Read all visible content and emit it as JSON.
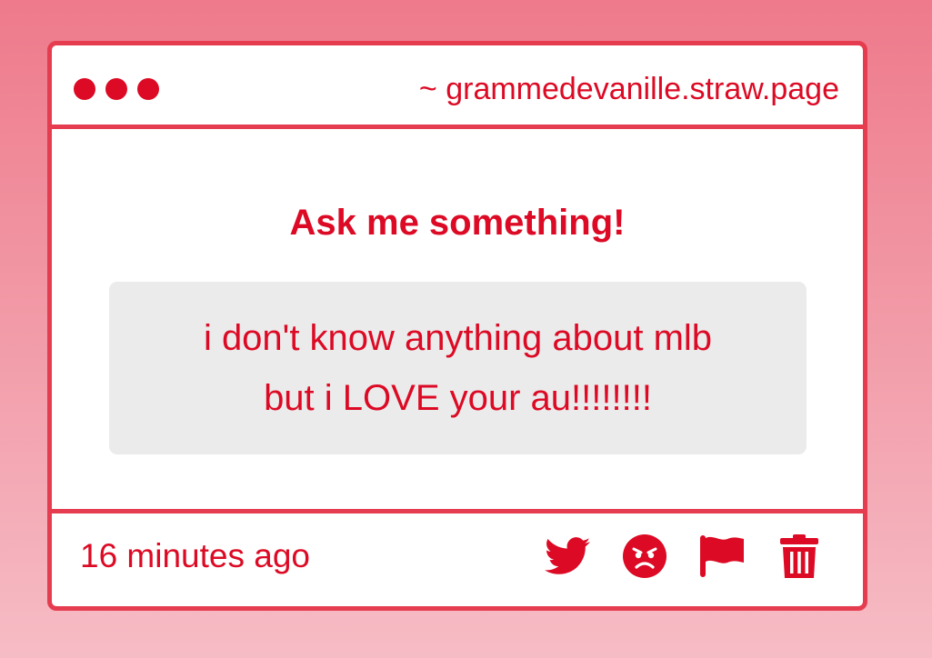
{
  "window": {
    "url": "~ grammedevanille.straw.page"
  },
  "main": {
    "heading": "Ask me something!",
    "question_line1": "i don't know anything about mlb",
    "question_line2": "but i LOVE your au!!!!!!!!"
  },
  "footer": {
    "timestamp": "16 minutes ago",
    "actions": [
      {
        "icon": "twitter-icon"
      },
      {
        "icon": "angry-face-icon"
      },
      {
        "icon": "flag-icon"
      },
      {
        "icon": "trash-icon"
      }
    ]
  },
  "colors": {
    "accent": "#dc0a24",
    "border": "#e53d4f",
    "background_top": "#ee7a8b",
    "background_bottom": "#f6bcc5",
    "question_bg": "#ecebec",
    "card_bg": "#ffffff"
  }
}
